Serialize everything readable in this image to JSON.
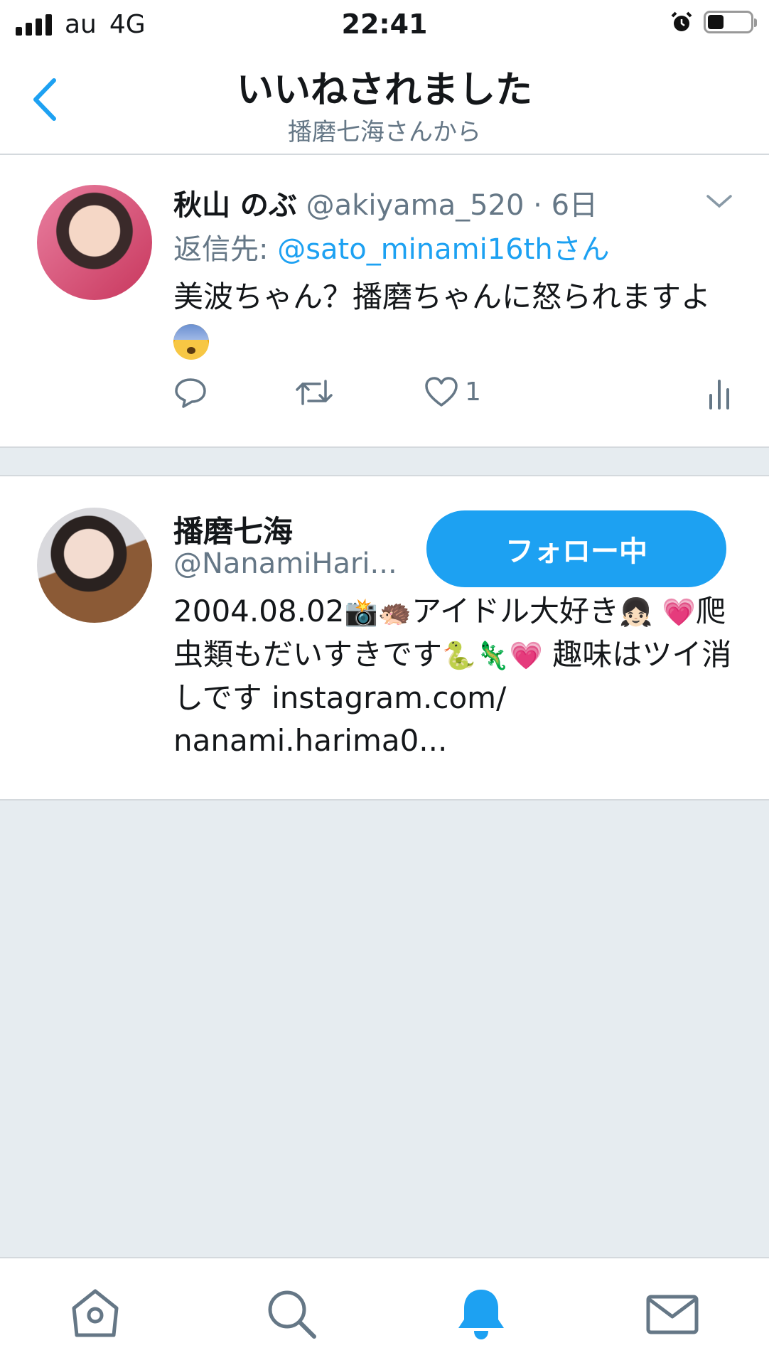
{
  "status_bar": {
    "carrier": "au",
    "network": "4G",
    "time": "22:41"
  },
  "header": {
    "title": "いいねされました",
    "subtitle": "播磨七海さんから"
  },
  "tweet": {
    "author_name": "秋山 のぶ",
    "handle": "@akiyama_520",
    "separator": "·",
    "age": "6日",
    "reply_prefix": "返信先:",
    "reply_target": "@sato_minami16thさん",
    "text": "美波ちゃん？播磨ちゃんに怒られますよ",
    "like_count": "1"
  },
  "user": {
    "name": "播磨七海",
    "handle": "@NanamiHari...",
    "follow_label": "フォロー中",
    "bio_part1": "2004.08.02",
    "bio_part2": "アイドル大好き",
    "bio_part3": "爬虫類もだいすきです",
    "bio_part4": "趣味はツイ消しです instagram.com/ nanami.harima0..."
  },
  "colors": {
    "accent": "#1da1f2",
    "secondary_text": "#657786",
    "background": "#e6ecf0"
  }
}
